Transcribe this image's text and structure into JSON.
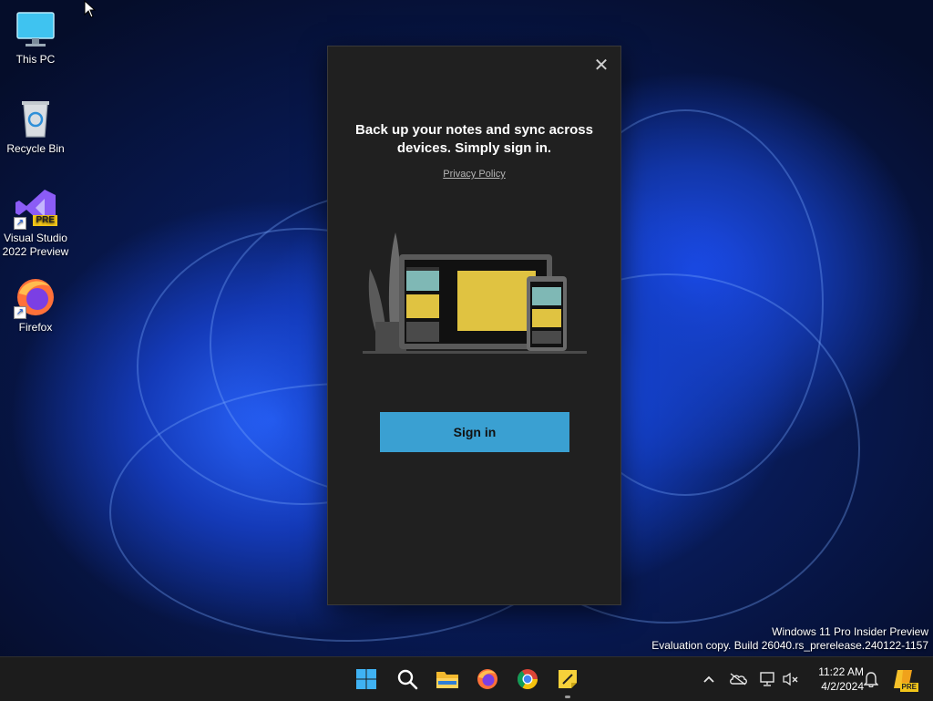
{
  "desktop": {
    "icons": [
      {
        "label": "This PC",
        "icon": "monitor-icon"
      },
      {
        "label": "Recycle Bin",
        "icon": "recycle-bin-icon"
      },
      {
        "label": "Visual Studio 2022 Preview",
        "icon": "visual-studio-icon",
        "badge": "PRE"
      },
      {
        "label": "Firefox",
        "icon": "firefox-icon"
      }
    ]
  },
  "dialog": {
    "title": "Back up your notes and sync across devices. Simply sign in.",
    "privacy_link": "Privacy Policy",
    "sign_in_label": "Sign in",
    "close_icon": "close-icon",
    "accent_color": "#3aa0d2"
  },
  "watermark": {
    "line1": "Windows 11 Pro Insider Preview",
    "line2": "Evaluation copy. Build 26040.rs_prerelease.240122-1157"
  },
  "taskbar": {
    "apps": [
      "start-icon",
      "search-icon",
      "file-explorer-icon",
      "firefox-icon",
      "chrome-icon",
      "sticky-notes-icon"
    ],
    "tray": [
      "chevron-up-icon",
      "onedrive-icon",
      "network-icon",
      "volume-muted-icon"
    ],
    "time": "11:22 AM",
    "date": "4/2/2024",
    "notification_icon": "bell-icon",
    "copilot_badge": "PRE"
  }
}
